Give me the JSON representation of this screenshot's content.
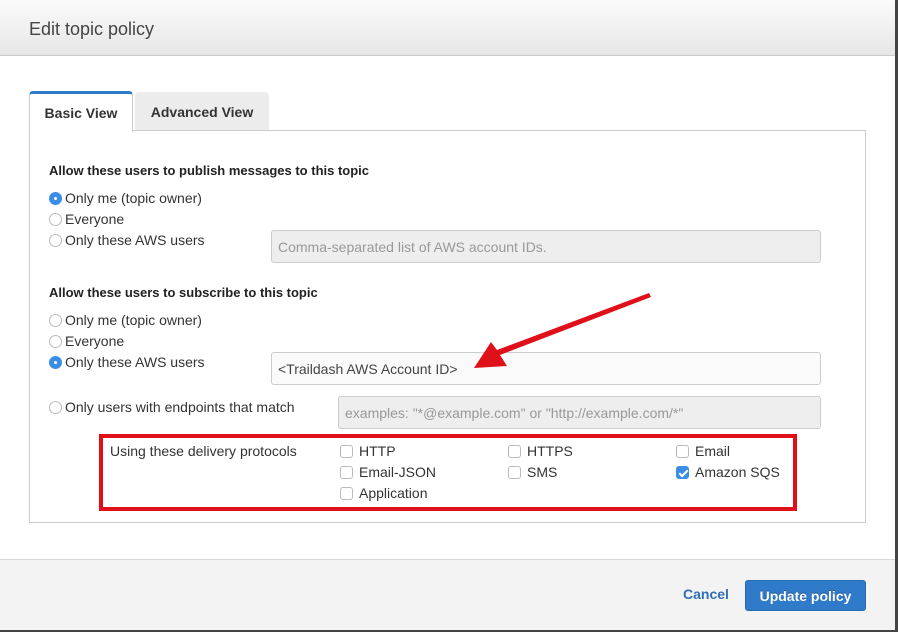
{
  "dialog": {
    "title": "Edit topic policy"
  },
  "tabs": [
    {
      "label": "Basic View",
      "active": true
    },
    {
      "label": "Advanced View",
      "active": false
    }
  ],
  "publish": {
    "title": "Allow these users to publish messages to this topic",
    "options": [
      {
        "label": "Only me (topic owner)",
        "selected": true
      },
      {
        "label": "Everyone",
        "selected": false
      },
      {
        "label": "Only these AWS users",
        "selected": false
      }
    ],
    "aws_users_placeholder": "Comma-separated list of AWS account IDs."
  },
  "subscribe": {
    "title": "Allow these users to subscribe to this topic",
    "options": [
      {
        "label": "Only me (topic owner)",
        "selected": false
      },
      {
        "label": "Everyone",
        "selected": false
      },
      {
        "label": "Only these AWS users",
        "selected": true
      },
      {
        "label": "Only users with endpoints that match",
        "selected": false
      }
    ],
    "aws_users_value": "<Traildash AWS Account ID>",
    "endpoints_placeholder": "examples: \"*@example.com\" or \"http://example.com/*\"",
    "protocols_label": "Using these delivery protocols",
    "protocols": [
      {
        "label": "HTTP",
        "checked": false
      },
      {
        "label": "HTTPS",
        "checked": false
      },
      {
        "label": "Email",
        "checked": false
      },
      {
        "label": "Email-JSON",
        "checked": false
      },
      {
        "label": "SMS",
        "checked": false
      },
      {
        "label": "Amazon SQS",
        "checked": true
      },
      {
        "label": "Application",
        "checked": false
      }
    ]
  },
  "footer": {
    "cancel_label": "Cancel",
    "update_label": "Update policy"
  },
  "annotation": {
    "color": "#e0101a"
  }
}
